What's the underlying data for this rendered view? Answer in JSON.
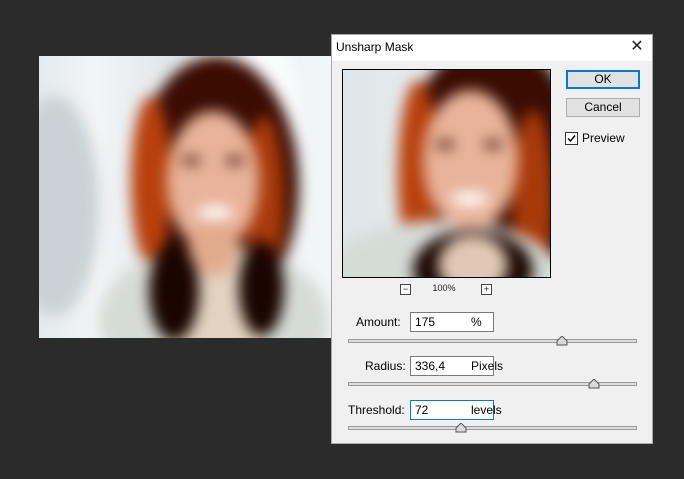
{
  "dialog": {
    "title": "Unsharp Mask",
    "ok_label": "OK",
    "cancel_label": "Cancel",
    "preview_label": "Preview",
    "preview_checked": true,
    "zoom_level": "100%",
    "zoom_out": "−",
    "zoom_in": "+",
    "close_glyph": "✕"
  },
  "params": {
    "amount": {
      "label": "Amount:",
      "value": "175",
      "unit": "%",
      "slider_position": 0.74
    },
    "radius": {
      "label": "Radius:",
      "value": "336,4",
      "unit": "Pixels",
      "slider_position": 0.85
    },
    "threshold": {
      "label": "Threshold:",
      "value": "72",
      "unit": "levels",
      "slider_position": 0.39
    }
  },
  "colors": {
    "workspace_bg": "#2b2b2b",
    "dialog_bg": "#f0f0f0",
    "accent": "#0078d7",
    "hair": "#3a0c02",
    "hair_highlight": "#b8400c",
    "skin": "#e8b39a"
  },
  "icons": {
    "close": "close-icon",
    "zoom_out": "zoom-out-icon",
    "zoom_in": "zoom-in-icon",
    "checkbox": "checkmark-icon",
    "slider_thumb": "slider-thumb-icon"
  }
}
